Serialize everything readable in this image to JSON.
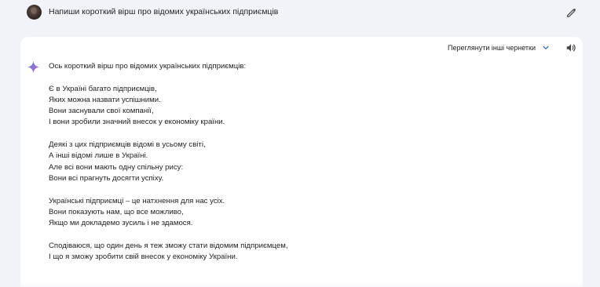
{
  "prompt": {
    "text": "Напиши короткий вірш про відомих українських підприємців"
  },
  "response": {
    "drafts_label": "Переглянути інші чернетки",
    "intro": "Ось короткий вірш про відомих українських підприємців:",
    "stanzas": [
      [
        "Є в Україні багато підприємців,",
        "Яких можна назвати успішними.",
        "Вони заснували свої компанії,",
        "І вони зробили значний внесок у економіку країни."
      ],
      [
        "Деякі з цих підприємців відомі в усьому світі,",
        "А інші відомі лише в Україні.",
        "Але всі вони мають одну спільну рису:",
        "Вони всі прагнуть досягти успіху."
      ],
      [
        "Українські підприємці – це натхнення для нас усіх.",
        "Вони показують нам, що все можливо,",
        "Якщо ми докладемо зусиль і не здамося."
      ],
      [
        "Сподіваюся, що один день я теж зможу стати відомим підприємцем,",
        "І що я зможу зробити свій внесок у економіку України."
      ]
    ]
  },
  "colors": {
    "background": "#f0f4f9",
    "card": "#ffffff",
    "text": "#1f1f1f",
    "accent_blue": "#4285f4",
    "accent_red": "#d96570"
  },
  "icons": {
    "avatar": "user-avatar",
    "edit": "pencil-icon",
    "drafts_toggle": "chevron-down-icon",
    "read_aloud": "speaker-icon",
    "assistant": "sparkle-icon"
  }
}
